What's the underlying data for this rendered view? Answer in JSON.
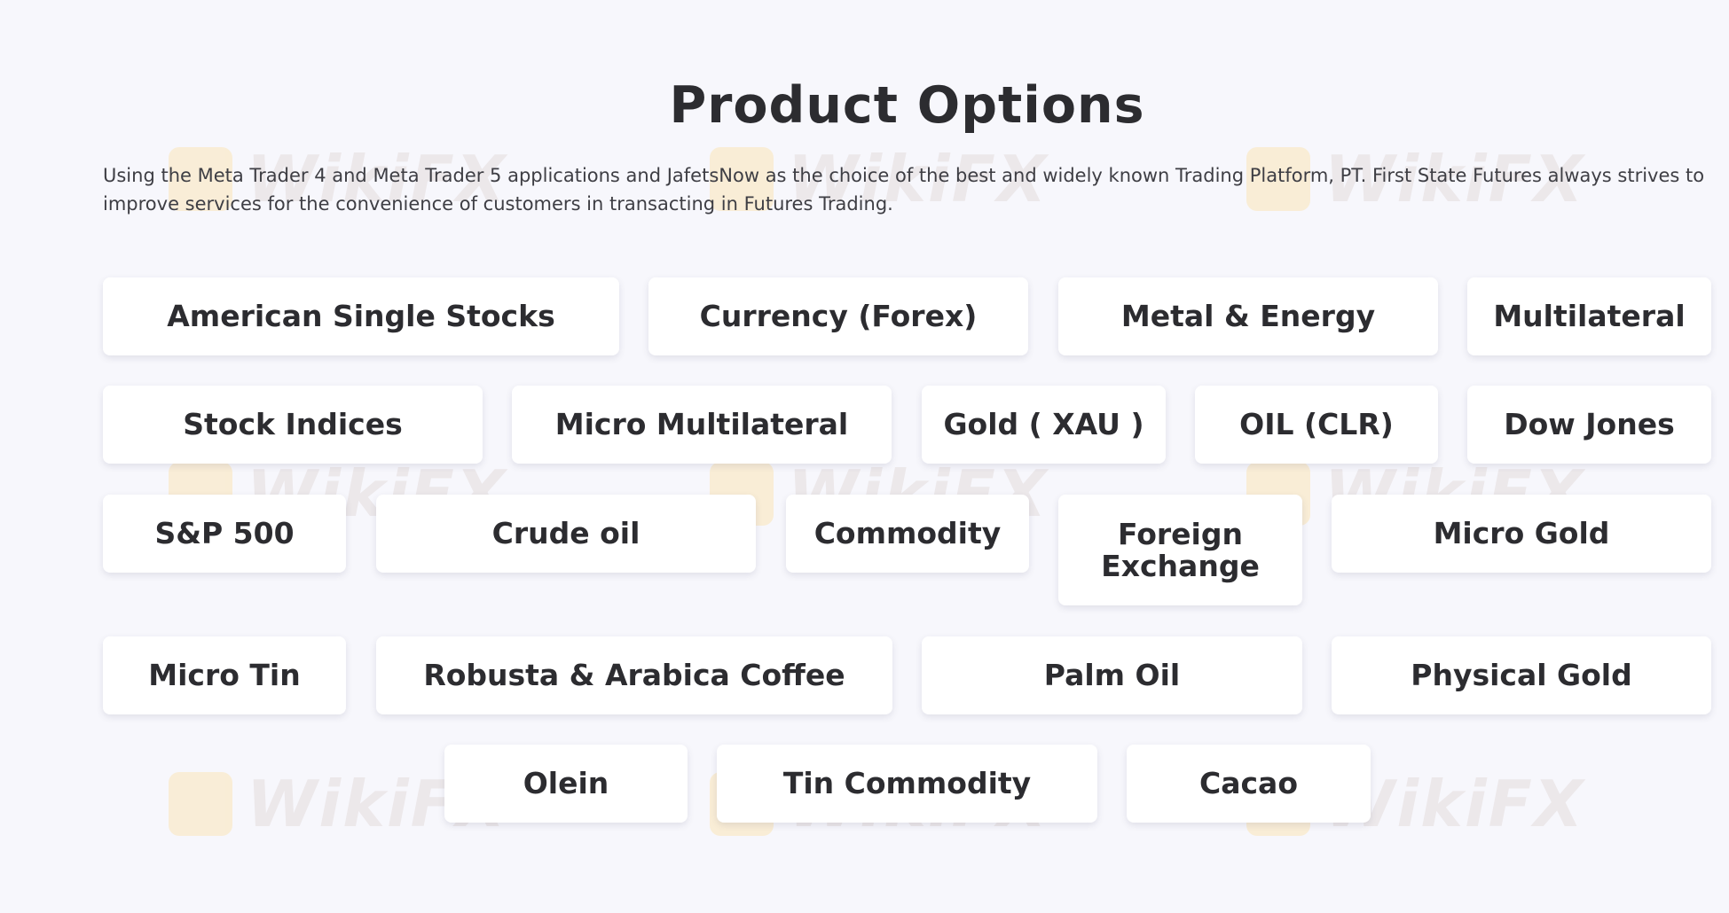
{
  "header": {
    "title": "Product Options",
    "description": "Using the Meta Trader 4 and Meta Trader 5 applications and JafetsNow as the choice of the best and widely known Trading Platform, PT. First State Futures always strives to improve services for the convenience of customers in transacting in Futures Trading."
  },
  "watermark": {
    "text": "WikiFX"
  },
  "products": [
    {
      "label": "American Single Stocks"
    },
    {
      "label": "Currency (Forex)"
    },
    {
      "label": "Metal & Energy"
    },
    {
      "label": "Multilateral"
    },
    {
      "label": "Stock Indices"
    },
    {
      "label": "Micro Multilateral"
    },
    {
      "label": "Gold ( XAU )"
    },
    {
      "label": "OIL (CLR)"
    },
    {
      "label": "Dow Jones"
    },
    {
      "label": "S&P 500"
    },
    {
      "label": "Crude oil"
    },
    {
      "label": "Commodity"
    },
    {
      "label": "Foreign Exchange"
    },
    {
      "label": "Micro Gold"
    },
    {
      "label": "Micro Tin"
    },
    {
      "label": "Robusta & Arabica Coffee"
    },
    {
      "label": "Palm Oil"
    },
    {
      "label": "Physical Gold"
    },
    {
      "label": "Olein"
    },
    {
      "label": "Tin Commodity"
    },
    {
      "label": "Cacao"
    }
  ]
}
